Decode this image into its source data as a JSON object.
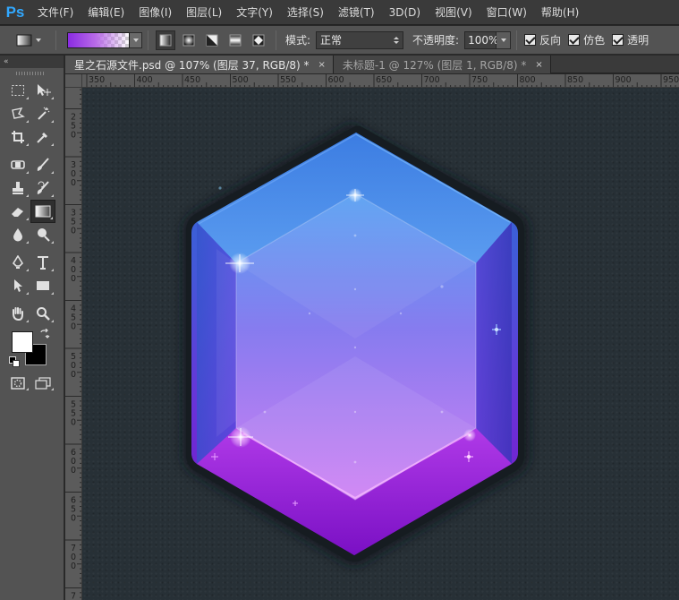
{
  "app": {
    "logo_text": "Ps"
  },
  "menubar": {
    "items": [
      "文件(F)",
      "编辑(E)",
      "图像(I)",
      "图层(L)",
      "文字(Y)",
      "选择(S)",
      "滤镜(T)",
      "3D(D)",
      "视图(V)",
      "窗口(W)",
      "帮助(H)"
    ]
  },
  "options": {
    "mode_label": "模式:",
    "mode_value": "正常",
    "opacity_label": "不透明度:",
    "opacity_value": "100%",
    "reverse_label": "反向",
    "dither_label": "仿色",
    "transparency_label": "透明",
    "gradient_colors": [
      "#8a2be2",
      "#ffffff"
    ]
  },
  "tabs": [
    {
      "label": "星之石源文件.psd @ 107% (图层 37, RGB/8) *",
      "close": "×"
    },
    {
      "label": "未标题-1 @ 127% (图层 1, RGB/8) *",
      "close": "×"
    }
  ],
  "toolbox": {
    "collapse_label": "«",
    "foreground_color": "#ffffff",
    "background_color": "#000000"
  },
  "ruler": {
    "top_labels": [
      "350",
      "400",
      "450",
      "500",
      "550",
      "600",
      "650",
      "700",
      "750",
      "800",
      "850",
      "900",
      "950"
    ],
    "left_labels": [
      [
        "2"
      ],
      [
        "2",
        "5",
        "0"
      ],
      [
        "3",
        "0",
        "0"
      ],
      [
        "3",
        "5",
        "0"
      ],
      [
        "4",
        "0",
        "0"
      ],
      [
        "4",
        "5",
        "0"
      ],
      [
        "5",
        "0",
        "0"
      ],
      [
        "5",
        "5",
        "0"
      ],
      [
        "6",
        "0",
        "0"
      ],
      [
        "6",
        "5",
        "0"
      ],
      [
        "7",
        "0",
        "0"
      ],
      [
        "7"
      ]
    ]
  },
  "canvas": {
    "background_color": "#273036",
    "gem_colors": {
      "top": "#2a6fd6",
      "top_light": "#4fa8f0",
      "mid": "#6a4ee0",
      "bottom": "#8a1ad8",
      "bottom_light": "#c040f0",
      "face_top": "#5c8ff0",
      "face_bottom": "#c47af2",
      "outline": "#161c21"
    }
  }
}
